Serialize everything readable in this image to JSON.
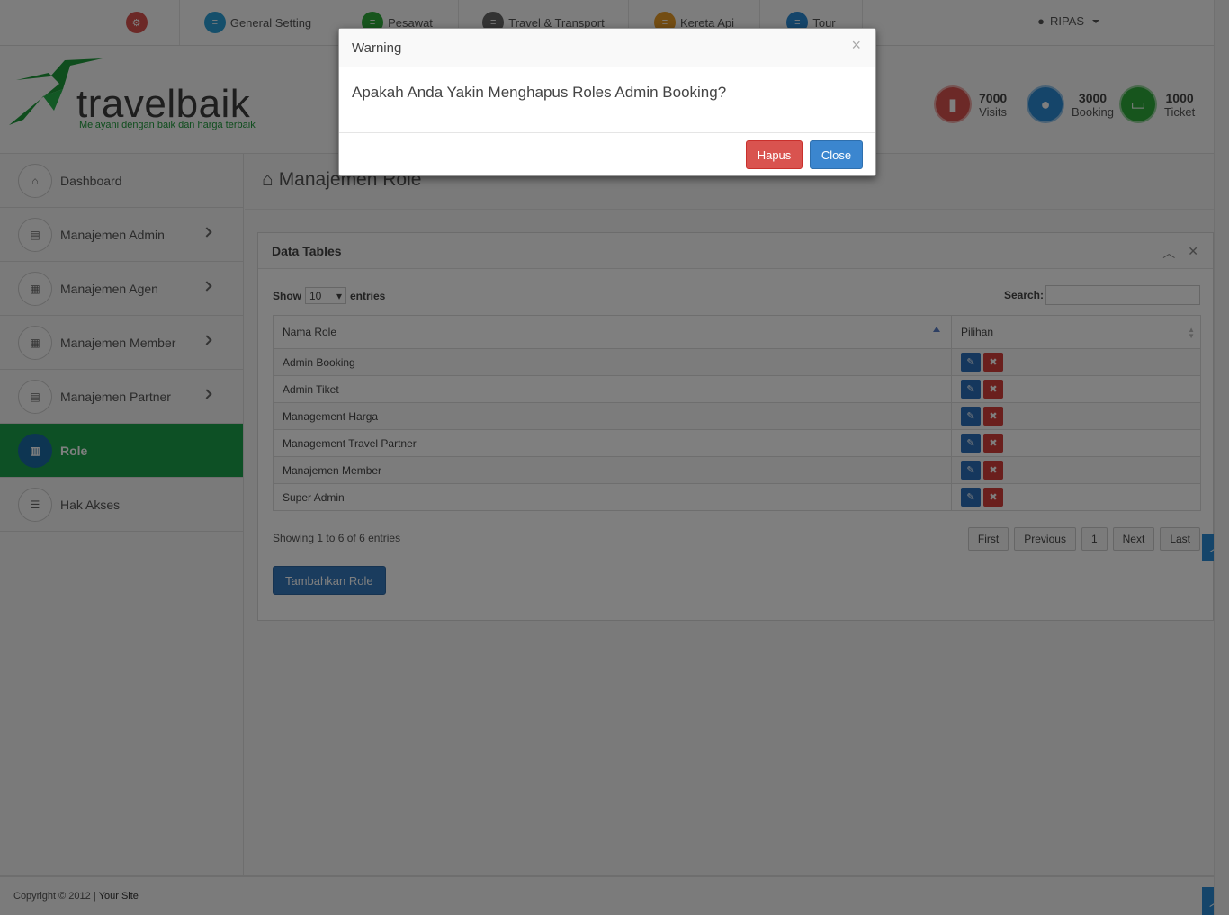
{
  "topnav": {
    "items": [
      {
        "label": "",
        "icon": "share-icon",
        "color": "#d9534f"
      },
      {
        "label": "General Setting",
        "icon": "stack-icon",
        "color": "#2a9fd6"
      },
      {
        "label": "Pesawat",
        "icon": "stack-icon",
        "color": "#2eaa3a"
      },
      {
        "label": "Travel & Transport",
        "icon": "stack-icon",
        "color": "#666666"
      },
      {
        "label": "Kereta Api",
        "icon": "stack-icon",
        "color": "#e69a27"
      },
      {
        "label": "Tour",
        "icon": "stack-icon",
        "color": "#2a8ad4"
      }
    ],
    "user": "RIPAS"
  },
  "header": {
    "logo_text": "travelbaik",
    "tagline": "Melayani dengan baik dan harga terbaik",
    "stats": [
      {
        "value": "7000",
        "label": "Visits",
        "icon": "signal-icon",
        "color": "#d9534f"
      },
      {
        "value": "3000",
        "label": "Booking",
        "icon": "user-icon",
        "color": "#2a8ad4"
      },
      {
        "value": "1000",
        "label": "Ticket",
        "icon": "money-icon",
        "color": "#2eaa3a"
      }
    ]
  },
  "sidebar": {
    "items": [
      {
        "label": "Dashboard",
        "icon": "home-icon",
        "submenu": false
      },
      {
        "label": "Manajemen Admin",
        "icon": "list-icon",
        "submenu": true
      },
      {
        "label": "Manajemen Agen",
        "icon": "table-icon",
        "submenu": true
      },
      {
        "label": "Manajemen Member",
        "icon": "table-icon",
        "submenu": true
      },
      {
        "label": "Manajemen Partner",
        "icon": "list-icon",
        "submenu": true
      },
      {
        "label": "Role",
        "icon": "chart-icon",
        "submenu": false,
        "active": true
      },
      {
        "label": "Hak Akses",
        "icon": "tasks-icon",
        "submenu": false
      }
    ]
  },
  "main": {
    "title": "Manajemen Role",
    "panel_title": "Data Tables",
    "show_label": "Show",
    "show_value": "10",
    "entries_label": "entries",
    "search_label": "Search:",
    "columns": [
      "Nama Role",
      "Pilihan"
    ],
    "rows": [
      "Admin Booking",
      "Admin Tiket",
      "Management Harga",
      "Management Travel Partner",
      "Manajemen Member",
      "Super Admin"
    ],
    "info": "Showing 1 to 6 of 6 entries",
    "pager": [
      "First",
      "Previous",
      "1",
      "Next",
      "Last"
    ],
    "add_button": "Tambahkan Role"
  },
  "footer": {
    "copyright": "Copyright © 2012 |",
    "site": "Your Site"
  },
  "modal": {
    "title": "Warning",
    "close_symbol": "×",
    "message": "Apakah Anda Yakin Menghapus Roles Admin Booking?",
    "confirm_label": "Hapus",
    "close_label": "Close"
  }
}
